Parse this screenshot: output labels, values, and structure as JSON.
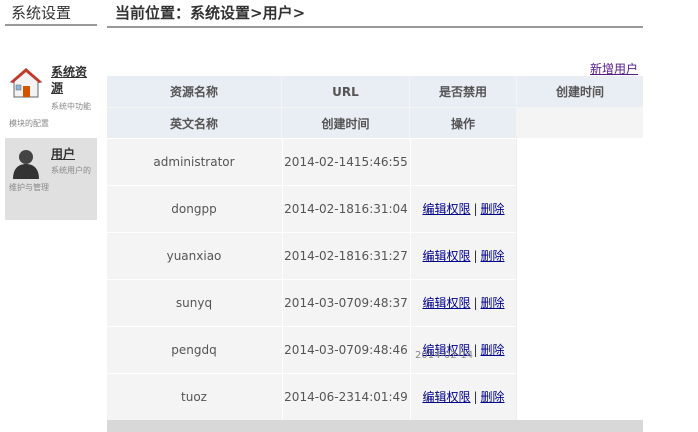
{
  "sidebar_header": "系统设置",
  "breadcrumb": "当前位置：系统设置>用户>",
  "sidebar": {
    "items": [
      {
        "icon": "home-icon",
        "title": "系统资源",
        "desc": "系统中功能模块的配置"
      },
      {
        "icon": "user-icon",
        "title": "用户",
        "desc": "系统用户的维护与管理"
      }
    ]
  },
  "actions": {
    "new_user": "新增用户"
  },
  "table": {
    "headers_row1": [
      "资源名称",
      "URL",
      "是否禁用",
      "创建时间"
    ],
    "headers_row2": [
      "英文名称",
      "创建时间",
      "操作"
    ],
    "edit_label": "编辑权限",
    "separator": "|",
    "delete_label": "删除",
    "rows": [
      {
        "name": "administrator",
        "date": "2014-02-14",
        "time": "15:46:55",
        "has_ops": false
      },
      {
        "name": "dongpp",
        "date": "2014-02-18",
        "time": "16:31:04",
        "has_ops": true
      },
      {
        "name": "yuanxiao",
        "date": "2014-02-18",
        "time": "16:31:27",
        "has_ops": true
      },
      {
        "name": "sunyq",
        "date": "2014-03-07",
        "time": "09:48:37",
        "has_ops": true
      },
      {
        "name": "pengdq",
        "date": "2014-03-07",
        "time": "09:48:46",
        "has_ops": true
      },
      {
        "name": "tuoz",
        "date": "2014-06-23",
        "time": "14:01:49",
        "has_ops": true
      }
    ],
    "partial_bottom_time": "2014-02-14"
  }
}
